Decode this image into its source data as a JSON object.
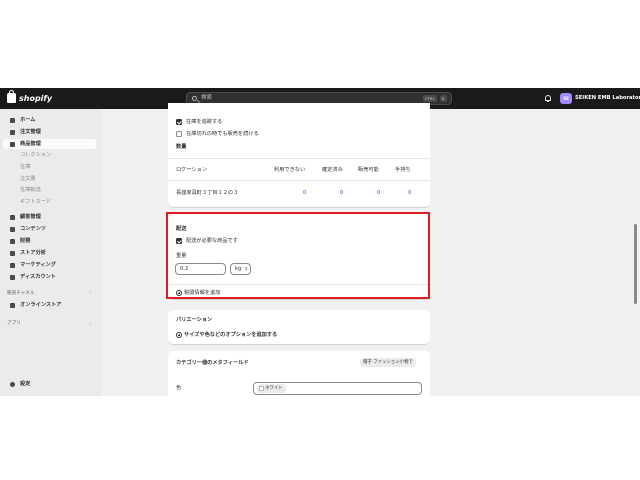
{
  "topbar": {
    "logo_text": "shopify",
    "search_placeholder": "検索",
    "shortcut_ctrl": "CTRL",
    "shortcut_k": "K",
    "avatar_initials": "SE",
    "store_name": "SEIKEN EMB Laboratory"
  },
  "sidebar": {
    "home": "ホーム",
    "orders": "注文管理",
    "products": "商品管理",
    "product_sub": [
      "コレクション",
      "在庫",
      "注文書",
      "在庫転送",
      "ギフトカード"
    ],
    "customers": "顧客管理",
    "content": "コンテンツ",
    "finance": "財務",
    "analytics": "ストア分析",
    "marketing": "マーケティング",
    "discounts": "ディスカウント",
    "sales_channels": "販売チャネル",
    "online_store": "オンラインストア",
    "apps": "アプリ",
    "settings": "設定",
    "chevron": "›"
  },
  "inventory": {
    "track_label": "在庫を追跡する",
    "continue_label": "在庫切れの時でも販売を続ける",
    "quantity_heading": "数量",
    "columns": [
      "ロケーション",
      "利用できない",
      "確定済み",
      "販売可能",
      "手持ち"
    ],
    "row": {
      "location": "長座家具町３丁目１２の３",
      "unavailable": "0",
      "committed": "0",
      "available": "0",
      "on_hand": "0"
    }
  },
  "shipping": {
    "title": "配送",
    "physical_label": "配送が必要な商品です",
    "weight_label": "重量",
    "weight_value": "0.2",
    "weight_unit": "kg",
    "customs_link": "税関情報を追加"
  },
  "variants": {
    "title": "バリエーション",
    "add_options": "サイズや色などのオプションを追加する"
  },
  "metafields": {
    "title": "カテゴリー値のメタフィールド",
    "badge_label": "帽子",
    "badge_category": "ファッション小物で",
    "color_label": "色",
    "color_value": "ホワイト"
  },
  "colors": {
    "topbar": "#1a1a1a",
    "highlight": "#e01b24",
    "link": "#005bd3"
  }
}
